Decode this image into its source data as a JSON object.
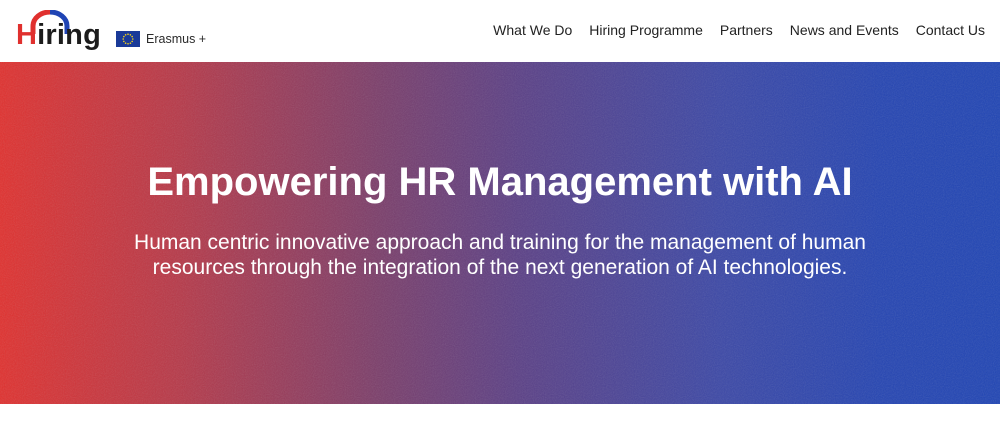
{
  "header": {
    "logo": {
      "text_h": "H",
      "text_rest": "iring",
      "arc_colors": [
        "#e0302e",
        "#1f44b4"
      ]
    },
    "erasmus": {
      "label": "Erasmus +",
      "flag_icon": "eu-flag-icon"
    },
    "nav": {
      "items": [
        {
          "label": "What We Do"
        },
        {
          "label": "Hiring Programme"
        },
        {
          "label": "Partners"
        },
        {
          "label": "News and Events"
        },
        {
          "label": "Contact Us"
        }
      ]
    }
  },
  "hero": {
    "title": "Empowering HR Management with AI",
    "subtitle": "Human centric innovative approach and training for the management of human resources through the integration of the next generation of AI technologies.",
    "gradient_colors": [
      "#e0302e",
      "#5a3f86",
      "#1f44b4"
    ]
  }
}
